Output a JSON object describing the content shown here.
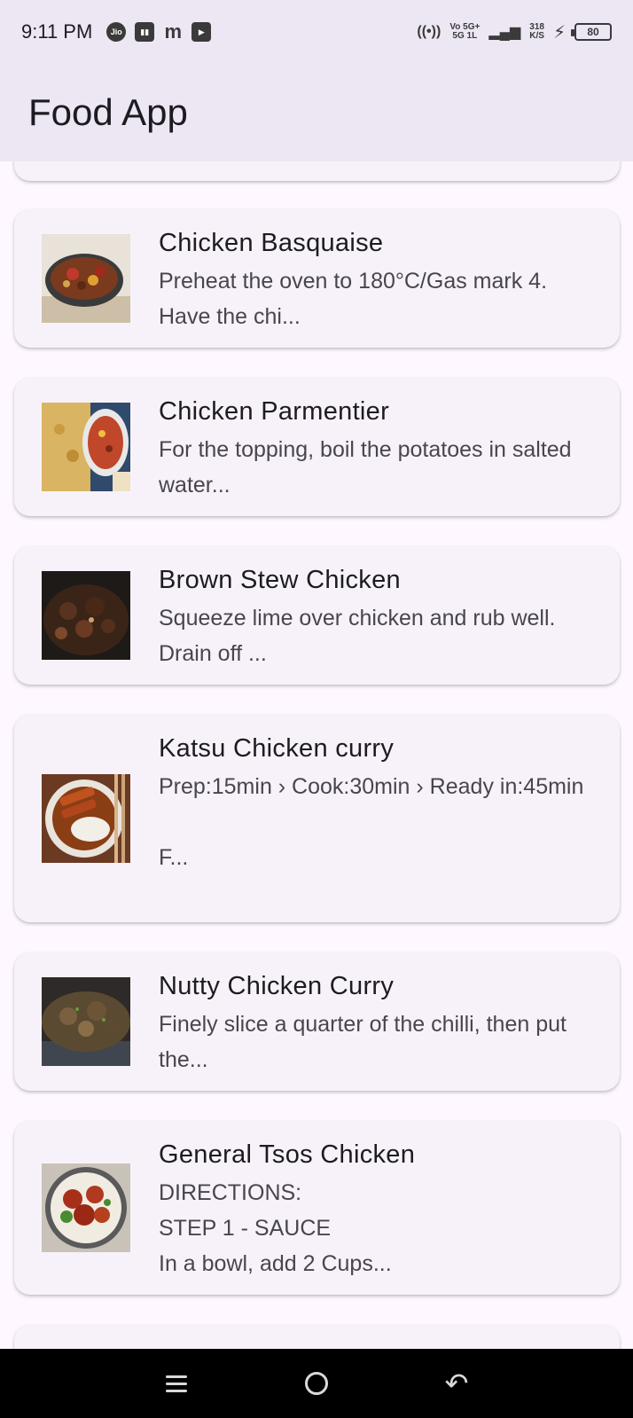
{
  "status_bar": {
    "time": "9:11 PM",
    "left_icons": [
      "jio-icon",
      "paytm-icon",
      "m-icon",
      "youtube-icon"
    ],
    "jio_label": "Jio",
    "m_label": "m",
    "network_top": "Vo 5G+",
    "network_bottom": "5G 1L",
    "speed_value": "318",
    "speed_unit": "K/S",
    "battery": "80"
  },
  "app_bar": {
    "title": "Food App"
  },
  "recipes": [
    {
      "title": "Chicken Basquaise",
      "description": "Preheat the oven to 180°C/Gas mark 4. Have the chi...",
      "image_icon": "chicken-basquaise-photo"
    },
    {
      "title": "Chicken Parmentier",
      "description": "For the topping, boil the potatoes in salted water...",
      "image_icon": "chicken-parmentier-photo"
    },
    {
      "title": "Brown Stew Chicken",
      "description": "Squeeze lime over chicken and rub well. Drain off ...",
      "image_icon": "brown-stew-chicken-photo"
    },
    {
      "title": "Katsu Chicken curry",
      "description": "Prep:15min  ›  Cook:30min  ›  Ready in:45min\n\nF...",
      "image_icon": "katsu-chicken-curry-photo"
    },
    {
      "title": "Nutty Chicken Curry",
      "description": "Finely slice a quarter of the chilli, then put the...",
      "image_icon": "nutty-chicken-curry-photo"
    },
    {
      "title": "General Tsos Chicken",
      "description": "DIRECTIONS:\nSTEP 1 - SAUCE\nIn a bowl, add 2 Cups...",
      "image_icon": "general-tsos-chicken-photo"
    }
  ],
  "nav_bar": {
    "buttons": [
      "recents-icon",
      "home-icon",
      "back-icon"
    ]
  }
}
